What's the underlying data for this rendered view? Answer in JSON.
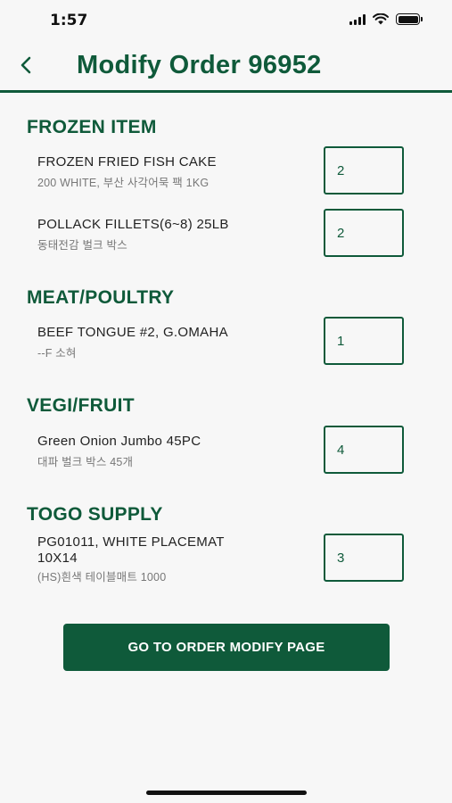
{
  "status_bar": {
    "time": "1:57"
  },
  "header": {
    "title": "Modify Order 96952"
  },
  "sections": [
    {
      "title": "FROZEN ITEM",
      "items": [
        {
          "name": "FROZEN FRIED FISH CAKE",
          "sub": "200 WHITE, 부산 사각어묵 팩 1KG",
          "qty": "2"
        },
        {
          "name": "POLLACK FILLETS(6~8) 25LB",
          "sub": "동태전감 벌크 박스",
          "qty": "2"
        }
      ]
    },
    {
      "title": "MEAT/POULTRY",
      "items": [
        {
          "name": "BEEF TONGUE #2, G.OMAHA",
          "sub": "--F 소혀",
          "qty": "1"
        }
      ]
    },
    {
      "title": "VEGI/FRUIT",
      "items": [
        {
          "name": "Green Onion Jumbo 45PC",
          "sub": "대파 벌크 박스  45개",
          "qty": "4"
        }
      ]
    },
    {
      "title": "TOGO SUPPLY",
      "items": [
        {
          "name_line1": "PG01011,  WHITE PLACEMAT",
          "name_line2": "10X14",
          "sub": "(HS)흰색 테이블매트 1000",
          "qty": "3"
        }
      ]
    }
  ],
  "cta": {
    "label": "GO TO ORDER MODIFY PAGE"
  },
  "colors": {
    "brand_green": "#0f5a3a",
    "background": "#f7f7f7"
  },
  "icons": [
    "cellular-signal-icon",
    "wifi-icon",
    "battery-icon",
    "back-chevron-icon"
  ]
}
